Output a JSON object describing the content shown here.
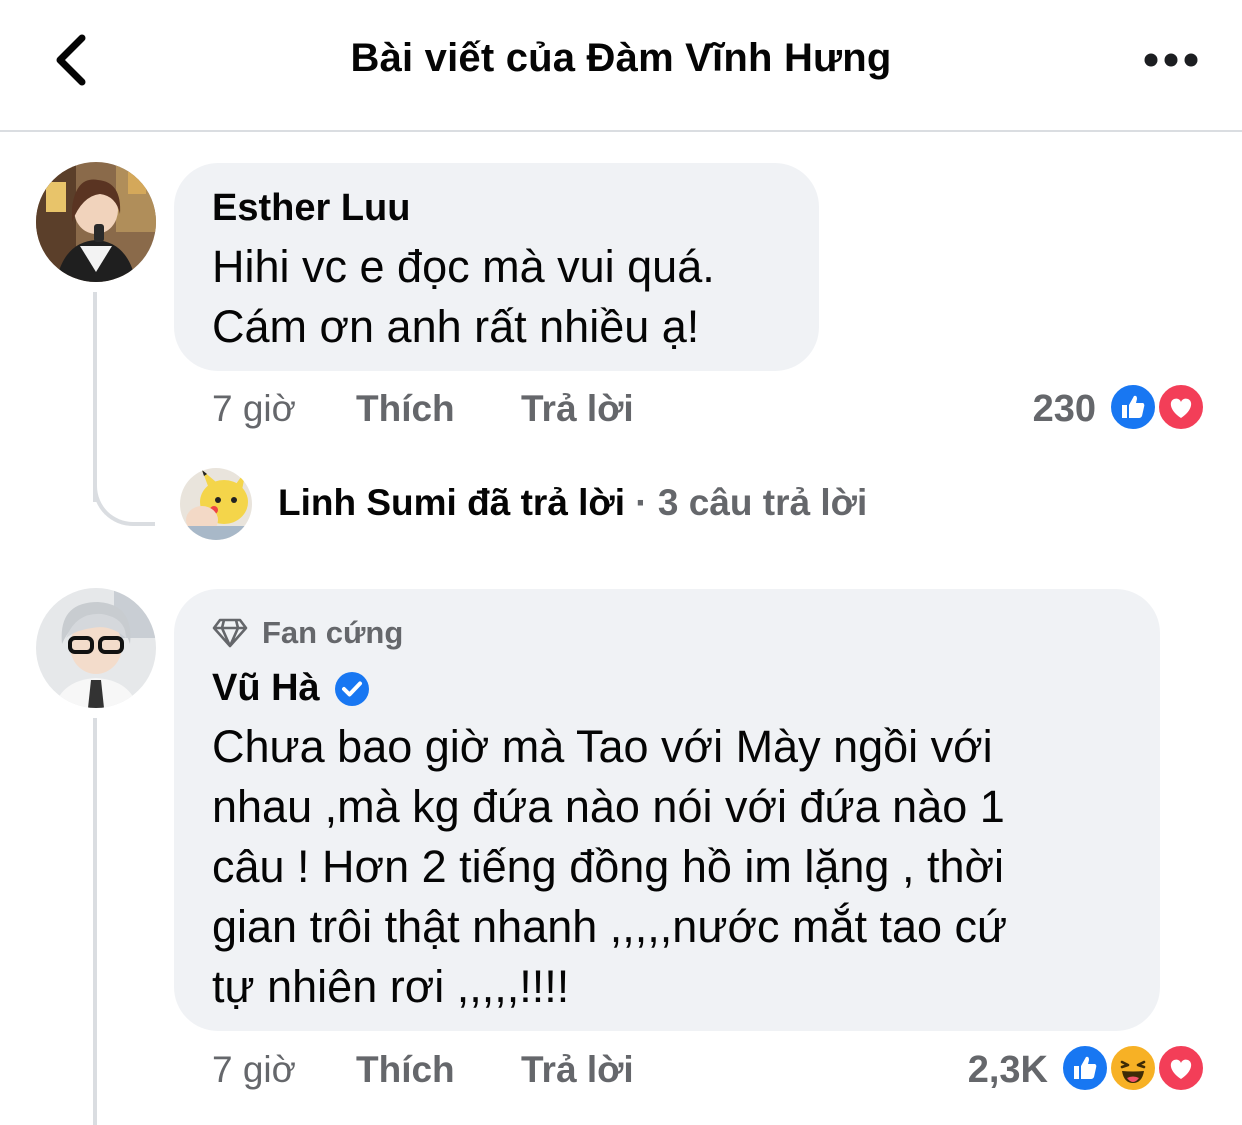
{
  "header": {
    "title": "Bài viết của Đàm Vĩnh Hưng"
  },
  "comments": [
    {
      "author": "Esther Luu",
      "text_line1": "Hihi vc e đọc mà vui quá.",
      "text_line2": "Cám ơn anh rất nhiều ạ!",
      "time": "7 giờ",
      "like_label": "Thích",
      "reply_label": "Trả lời",
      "reaction_count": "230",
      "reactions": [
        "like",
        "love"
      ]
    },
    {
      "badge": "Fan cứng",
      "author": "Vũ Hà",
      "verified": true,
      "text_line1": "Chưa bao giờ mà Tao với Mày ngồi với",
      "text_line2": "nhau ,mà kg đứa nào nói với đứa nào 1",
      "text_line3": "câu ! Hơn 2 tiếng đồng hồ im lặng , thời",
      "text_line4": "gian trôi thật nhanh ,,,,,nước mắt tao cứ",
      "text_line5": "tự nhiên rơi ,,,,,!!!!",
      "time": "7 giờ",
      "like_label": "Thích",
      "reply_label": "Trả lời",
      "reaction_count": "2,3K",
      "reactions": [
        "like",
        "haha",
        "love"
      ]
    }
  ],
  "reply_summary": {
    "name": "Linh Sumi",
    "action": "đã trả lời",
    "count": "· 3 câu trả lời"
  },
  "colors": {
    "like_blue": "#1877f2",
    "love_red": "#f33e58",
    "haha_yellow": "#f7b125",
    "bubble_bg": "#f0f2f5",
    "meta_gray": "#65676b"
  }
}
